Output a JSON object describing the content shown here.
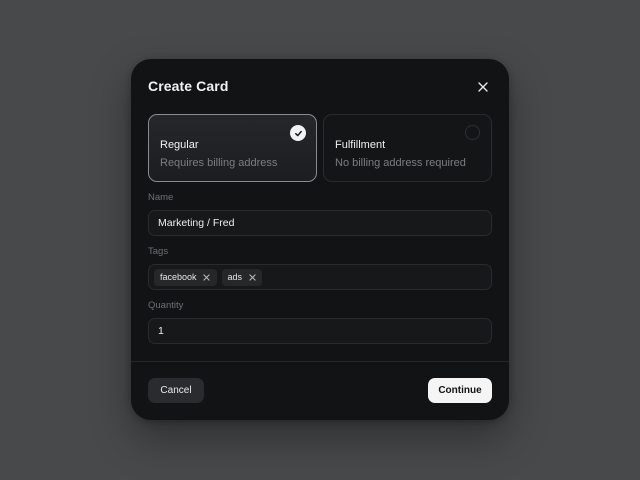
{
  "dialog": {
    "title": "Create Card",
    "card_types": [
      {
        "title": "Regular",
        "subtitle": "Requires billing address",
        "selected": true
      },
      {
        "title": "Fulfillment",
        "subtitle": "No billing address required",
        "selected": false
      }
    ],
    "name": {
      "label": "Name",
      "value": "Marketing / Fred"
    },
    "tags": {
      "label": "Tags",
      "items": [
        "facebook",
        "ads"
      ]
    },
    "quantity": {
      "label": "Quantity",
      "value": "1"
    },
    "cancel_label": "Cancel",
    "continue_label": "Continue"
  },
  "colors": {
    "backdrop": "#48494b",
    "surface": "#121315",
    "primary_button": "#f5f5f6"
  },
  "icons": {
    "close": "close-icon",
    "selected": "check-icon",
    "tag_remove": "x-icon"
  }
}
